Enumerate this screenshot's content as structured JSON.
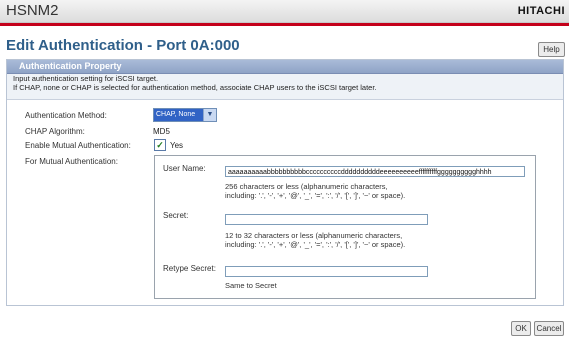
{
  "app": {
    "name": "HSNM2",
    "brand": "HITACHI"
  },
  "page": {
    "title": "Edit Authentication - Port 0A:000",
    "help_label": "Help"
  },
  "section": {
    "title": "Authentication Property",
    "description_line1": "Input authentication setting for iSCSI target.",
    "description_line2": "If CHAP, none or CHAP is selected for authentication method, associate CHAP users to the iSCSI target later."
  },
  "form": {
    "auth_method_label": "Authentication Method:",
    "auth_method_value": "CHAP, None",
    "chap_algorithm_label": "CHAP Algorithm:",
    "chap_algorithm_value": "MD5",
    "enable_mutual_label": "Enable Mutual Authentication:",
    "enable_mutual_checked": true,
    "enable_mutual_option": "Yes",
    "for_mutual_label": "For Mutual Authentication:"
  },
  "mutual": {
    "user_name_label": "User Name:",
    "user_name_value": "aaaaaaaaaabbbbbbbbbbccccccccccddddddddddeeeeeeeeeeffffffffffgggggggggghhhh",
    "user_name_hint1": "256 characters or less (alphanumeric characters,",
    "user_name_hint2": "including: '.', '-', '+', '@', '_', '=', ':', '/', '[', ']', '~' or space).",
    "secret_label": "Secret:",
    "secret_value": "",
    "secret_hint1": "12 to 32 characters or less (alphanumeric characters,",
    "secret_hint2": "including: '.', '-', '+', '@', '_', '=', ':', '/', '[', ']', '~' or space).",
    "retype_label": "Retype Secret:",
    "retype_value": "",
    "retype_hint": "Same to Secret"
  },
  "buttons": {
    "ok": "OK",
    "cancel": "Cancel"
  },
  "icons": {
    "dropdown": "chevron-down-icon",
    "checkbox": "checkmark-icon"
  },
  "colors": {
    "accent": "#2f5f8a",
    "brand_red": "#c4001a",
    "section_header": "#9aaece"
  }
}
